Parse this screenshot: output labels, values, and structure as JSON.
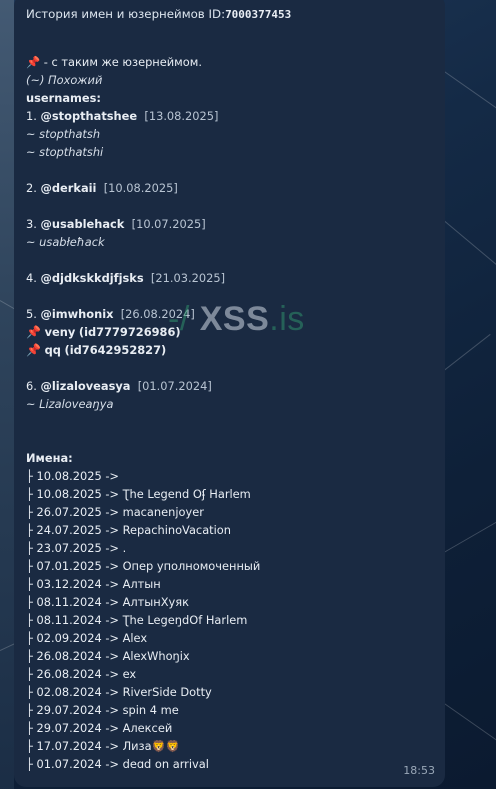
{
  "message": {
    "title": "История имен и юзернеймов",
    "id_label": "ID:",
    "id_value": "7000377453",
    "legend_same": "📌 - с таким же юзернеймом.",
    "legend_similar": "(~) Похожий",
    "usernames_header": "usernames:",
    "usernames": [
      {
        "num": "1.",
        "handle": "@stopthatshee",
        "date": "[13.08.2025]",
        "similar": [
          "~ stopthatsh",
          "~ stopthatshi"
        ],
        "pinned": []
      },
      {
        "num": "2.",
        "handle": "@derkaii",
        "date": "[10.08.2025]",
        "similar": [],
        "pinned": []
      },
      {
        "num": "3.",
        "handle": "@usablehack",
        "date": "[10.07.2025]",
        "similar": [
          "~ usabłeħack"
        ],
        "pinned": []
      },
      {
        "num": "4.",
        "handle": "@djdkskkdjfjsks",
        "date": "[21.03.2025]",
        "similar": [],
        "pinned": []
      },
      {
        "num": "5.",
        "handle": "@imwhonix",
        "date": "[26.08.2024]",
        "similar": [],
        "pinned": [
          {
            "pin": "📌",
            "name": "veny",
            "id": "(id7779726986)"
          },
          {
            "pin": "📌",
            "name": "qq",
            "id": "(id7642952827)"
          }
        ]
      },
      {
        "num": "6.",
        "handle": "@lizaloveasya",
        "date": "[01.07.2024]",
        "similar": [
          "~ Lizaloveaŋya"
        ],
        "pinned": []
      }
    ],
    "names_header": "Имена:",
    "names": [
      "├ 10.08.2025 ->",
      "├ 10.08.2025 -> Ʈhe Legend Oʄ Harlem",
      "├ 26.07.2025 -> macanenjoyer",
      "├ 24.07.2025 -> RepachinoVacation",
      "├ 23.07.2025 -> .",
      "├ 07.01.2025 -> Опер уполномоченный",
      "├ 03.12.2024 -> Алтын",
      "├ 08.11.2024 -> АлтынХуяк",
      "├ 08.11.2024 -> Ʈhe LegeŋdOf Harlem",
      "├ 02.09.2024 -> Alex",
      "├ 26.08.2024 -> AlexWhoŋix",
      "├ 26.08.2024 -> ex",
      "├ 02.08.2024 -> RiverSide Dotty",
      "├ 29.07.2024 -> spin 4 me",
      "├ 29.07.2024 -> Алексей",
      "├ 17.07.2024 -> Лиза🦁🦁",
      "├ 01.07.2024 -> deɑd on arrival"
    ],
    "time": "18:53"
  },
  "watermark": {
    "slash": "-/ ",
    "brand": "XSS",
    "dot": ".",
    "tld": "is"
  }
}
